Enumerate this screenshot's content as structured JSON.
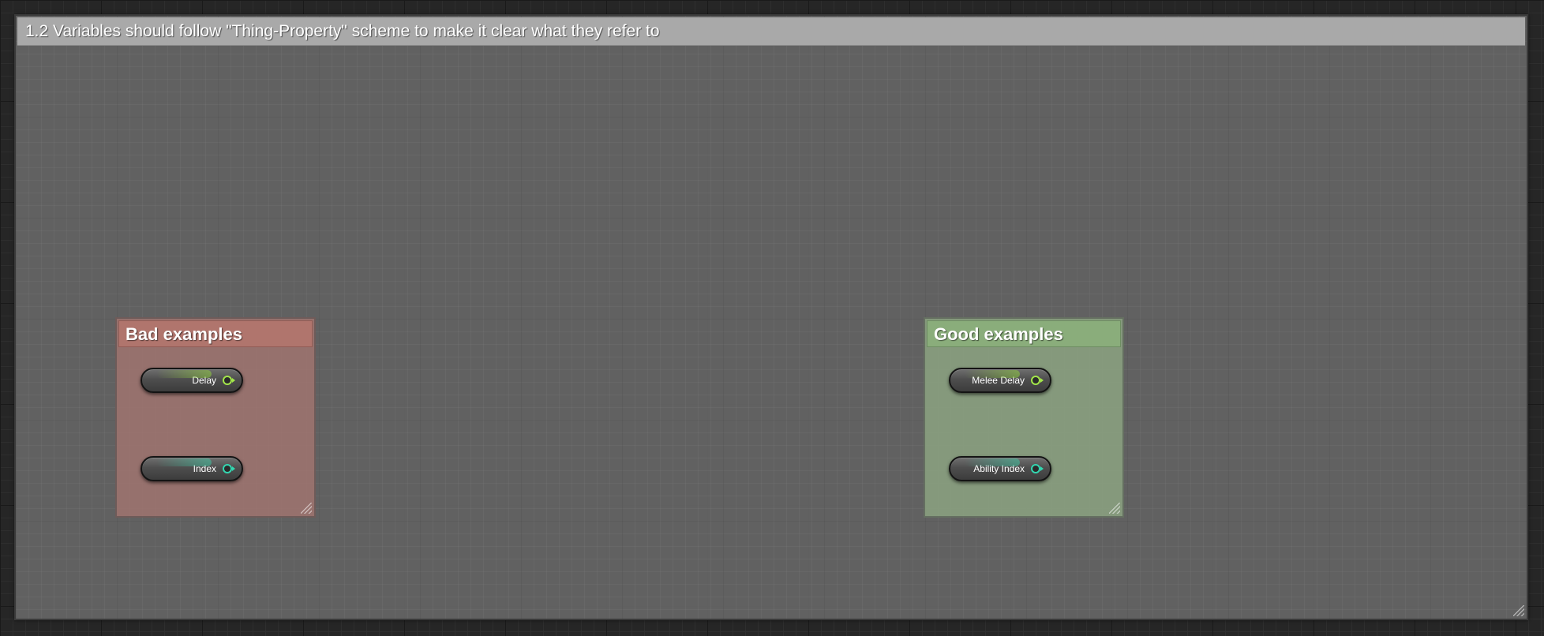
{
  "main_comment": {
    "title": "1.2 Variables should follow \"Thing-Property\" scheme to make it clear what they refer to",
    "color": "#a9a9a9"
  },
  "bad_group": {
    "title": "Bad examples",
    "color": "#b0756d",
    "nodes": [
      {
        "label": "Delay",
        "pin_type": "float",
        "pin_color": "#a3e64a"
      },
      {
        "label": "Index",
        "pin_type": "integer",
        "pin_color": "#33d6b0"
      }
    ]
  },
  "good_group": {
    "title": "Good examples",
    "color": "#8aad7b",
    "nodes": [
      {
        "label": "Melee Delay",
        "pin_type": "float",
        "pin_color": "#a3e64a"
      },
      {
        "label": "Ability Index",
        "pin_type": "integer",
        "pin_color": "#33d6b0"
      }
    ]
  },
  "icons": {
    "resize": "resize-grip-icon",
    "pin": "output-pin-icon"
  }
}
